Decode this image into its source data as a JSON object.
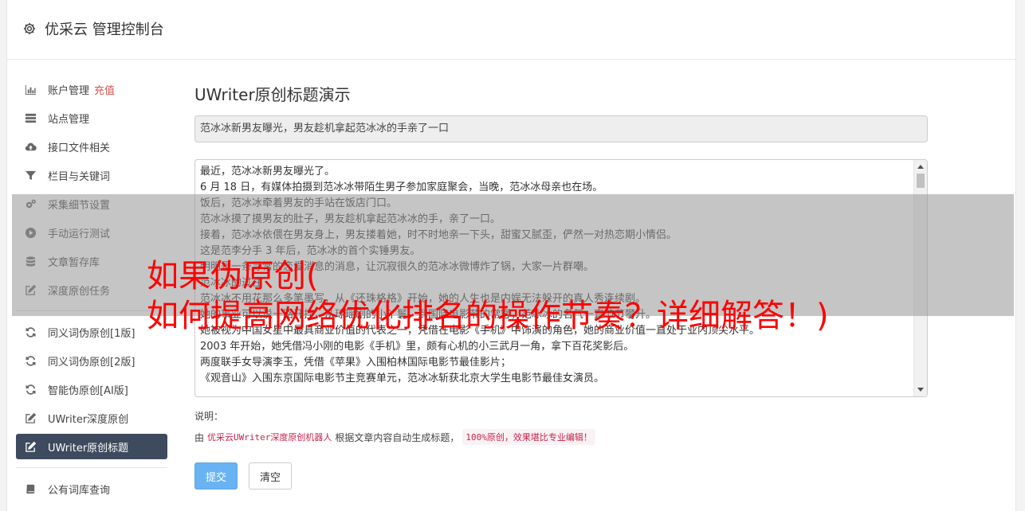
{
  "header": {
    "icon": "gear-icon",
    "title": "优采云 管理控制台"
  },
  "sidebar": {
    "groups": [
      [
        {
          "icon": "bar-chart-icon",
          "label": "账户管理",
          "extra": "充值"
        },
        {
          "icon": "server-icon",
          "label": "站点管理"
        },
        {
          "icon": "cloud-upload-icon",
          "label": "接口文件相关"
        },
        {
          "icon": "filter-icon",
          "label": "栏目与关键词"
        },
        {
          "icon": "gears-icon",
          "label": "采集细节设置"
        },
        {
          "icon": "play-circle-icon",
          "label": "手动运行测试"
        },
        {
          "icon": "database-icon",
          "label": "文章暂存库"
        },
        {
          "icon": "edit-icon",
          "label": "深度原创任务"
        }
      ],
      [
        {
          "icon": "refresh-icon",
          "label": "同义词伪原创[1版]"
        },
        {
          "icon": "refresh-icon",
          "label": "同义词伪原创[2版]"
        },
        {
          "icon": "refresh-icon",
          "label": "智能伪原创[AI版]"
        },
        {
          "icon": "edit-icon",
          "label": "UWriter深度原创"
        },
        {
          "icon": "edit-icon",
          "label": "UWriter原创标题",
          "active": true
        }
      ],
      [
        {
          "icon": "book-icon",
          "label": "公有词库查询"
        }
      ]
    ]
  },
  "main": {
    "title": "UWriter原创标题演示",
    "generated_title": "范冰冰新男友曝光，男友趁机拿起范冰冰的手亲了一口",
    "content_lines": [
      "最近，范冰冰新男友曝光了。",
      "6 月 18 日，有媒体拍摄到范冰冰带陌生男子参加家庭聚会，当晚，范冰冰母亲也在场。",
      "饭后，范冰冰牵着男友的手站在饭店门口。",
      "范冰冰摸了摸男友的肚子，男友趁机拿起范冰冰的手，亲了一口。",
      "接着，范冰冰依偎在男友身上，男友搂着她，时不时地亲一下头，甜蜜又腻歪，俨然一对热恋期小情侣。",
      "这是范李分手 3 年后，范冰冰的首个实锤男友。",
      "明明是一条寻常的恋爱消息的消息，让沉寂很久的范冰冰微博炸了锅，大家一片群嘲。",
      "范冰冰的过往",
      "范冰冰不用花那么多笔墨写，从《还珠格格》开始，她的人生也是内娱无法躲开的真人秀连续剧。",
      "她的事业可以说一路开挂，从琼瑶剧的小丫鬟，到国际电影节的常客，范冰冰的名气一直节节攀升。",
      "她被视为中国女星中最具商业价值的代表之一，凭借在电影《手机》中饰演的角色，她的商业价值一直处于业内顶尖水平。",
      "2003 年开始，她凭借冯小刚的电影《手机》里，颇有心机的小三武月一角，拿下百花奖影后。",
      "两度联手女导演李玉，凭借《苹果》入围柏林国际电影节最佳影片；",
      "《观音山》入围东京国际电影节主竞赛单元，范冰冰斩获北京大学生电影节最佳女演员。"
    ],
    "note_label": "说明：",
    "note": {
      "prefix": "由",
      "highlight": "优采云UWriter深度原创机器人",
      "middle": "根据文章内容自动生成标题，",
      "badge": "100%原创，效果堪比专业编辑！"
    },
    "buttons": {
      "submit": "提交",
      "clear": "清空"
    }
  },
  "overlay": {
    "line1": "如果伪原创(",
    "line2": "如何提高网络优化排名的操作节奏？详细解答！)"
  },
  "colors": {
    "active_nav": "#3e4a5d",
    "primary_button": "#69b3f4",
    "overlay_text": "#ff0000",
    "highlight_text": "#c7254e"
  }
}
